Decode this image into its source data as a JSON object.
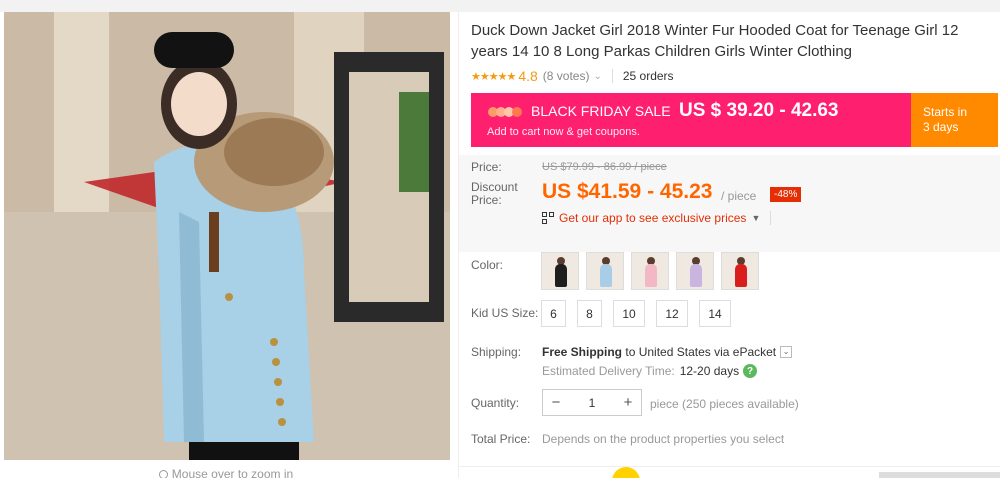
{
  "product": {
    "title": "Duck Down Jacket Girl 2018 Winter Fur Hooded Coat for Teenage Girl 12 years 14 10 8 Long Parkas Children Girls Winter Clothing",
    "stars": "★★★★★",
    "rating": "4.8",
    "votes": "(8 votes)",
    "orders": "25 orders"
  },
  "promo": {
    "sale_label": "BLACK FRIDAY SALE",
    "sale_price": "US $ 39.20 - 42.63",
    "subtext": "Add to cart now & get coupons.",
    "starts_label": "Starts in",
    "starts_value": "3 days",
    "accent_color": "#ff1f6f",
    "side_color": "#ff8a00"
  },
  "pricing": {
    "price_label": "Price:",
    "original_price": "US $79.99 - 86.99 / piece",
    "discount_label_1": "Discount",
    "discount_label_2": "Price:",
    "discount_price": "US $41.59 - 45.23",
    "unit": "/ piece",
    "discount_badge": "-48%",
    "app_offer": "Get our app to see exclusive prices"
  },
  "options": {
    "color_label": "Color:",
    "colors": [
      {
        "icon": "black-coat-swatch",
        "color": "#1e1e1e"
      },
      {
        "icon": "light-blue-coat-swatch",
        "color": "#a9cde6"
      },
      {
        "icon": "pink-coat-swatch",
        "color": "#f2b8c6"
      },
      {
        "icon": "lavender-coat-swatch",
        "color": "#c9b5e0"
      },
      {
        "icon": "red-coat-swatch",
        "color": "#d91e1e"
      }
    ],
    "size_label": "Kid US Size:",
    "sizes": [
      "6",
      "8",
      "10",
      "12",
      "14"
    ]
  },
  "shipping": {
    "label": "Shipping:",
    "free": "Free Shipping",
    "to": "to",
    "destination": "United States via ePacket",
    "estimate_label": "Estimated Delivery Time:",
    "estimate_value": "12-20 days"
  },
  "quantity": {
    "label": "Quantity:",
    "minus": "−",
    "value": "1",
    "plus": "+",
    "availability": "piece (250 pieces available)"
  },
  "total": {
    "label": "Total Price:",
    "note": "Depends on the product properties you select"
  },
  "gallery": {
    "zoom_hint": "Mouse over to zoom in"
  }
}
